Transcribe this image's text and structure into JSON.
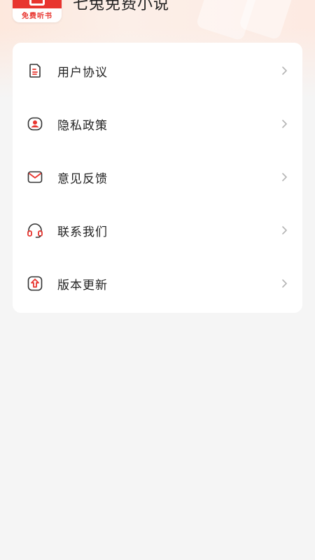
{
  "header": {
    "app_title": "七兔免费小说",
    "logo_text": "免费听书"
  },
  "menu": {
    "items": [
      {
        "label": "用户协议",
        "icon": "document-icon"
      },
      {
        "label": "隐私政策",
        "icon": "privacy-user-icon"
      },
      {
        "label": "意见反馈",
        "icon": "mail-icon"
      },
      {
        "label": "联系我们",
        "icon": "headset-icon"
      },
      {
        "label": "版本更新",
        "icon": "upgrade-icon"
      }
    ]
  },
  "colors": {
    "accent": "#e8352f",
    "icon_stroke": "#333333",
    "chevron": "#b5b5b5",
    "background": "#f5f5f5"
  }
}
